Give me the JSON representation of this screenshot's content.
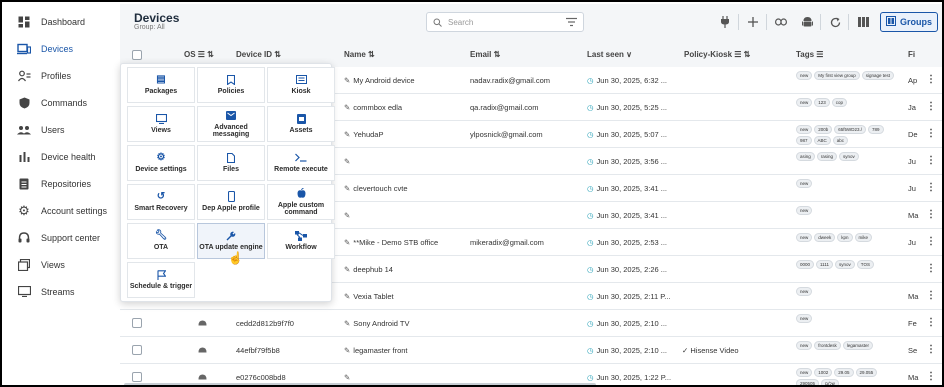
{
  "sidebar": {
    "items": [
      {
        "label": "Dashboard",
        "icon": "dashboard-icon"
      },
      {
        "label": "Devices",
        "icon": "devices-icon",
        "active": true
      },
      {
        "label": "Profiles",
        "icon": "profiles-icon"
      },
      {
        "label": "Commands",
        "icon": "shield-icon"
      },
      {
        "label": "Users",
        "icon": "users-icon"
      },
      {
        "label": "Device health",
        "icon": "bar-chart-icon"
      },
      {
        "label": "Repositories",
        "icon": "repositories-icon"
      },
      {
        "label": "Account settings",
        "icon": "gear-icon"
      },
      {
        "label": "Support center",
        "icon": "headset-icon"
      },
      {
        "label": "Views",
        "icon": "views-icon"
      },
      {
        "label": "Streams",
        "icon": "streams-icon"
      }
    ]
  },
  "header": {
    "title": "Devices",
    "subtitle": "Group: All",
    "search_placeholder": "Search",
    "groups_label": "Groups",
    "accent": "#1a56a8"
  },
  "table": {
    "headers": {
      "os": "OS",
      "device_id": "Device ID",
      "name": "Name",
      "email": "Email",
      "last_seen": "Last seen",
      "policy": "Policy-Kiosk",
      "tags": "Tags",
      "extra": "Fi"
    },
    "rows": [
      {
        "device_id": "",
        "name": "My Android device",
        "email": "nadav.radix@gmail.com",
        "seen": "Jun 30, 2025, 6:32 ...",
        "policy": "",
        "tags": [
          "new",
          "My first view group",
          "signage test"
        ],
        "extra": "Ap"
      },
      {
        "device_id": "",
        "name": "commbox edla",
        "email": "qa.radix@gmail.com",
        "seen": "Jun 30, 2025, 5:25 ...",
        "policy": "",
        "tags": [
          "new",
          "123",
          "cop"
        ],
        "extra": "Ja"
      },
      {
        "device_id": "",
        "name": "YehudaP",
        "email": "ylposnick@gmail.com",
        "seen": "Jun 30, 2025, 5:07 ...",
        "policy": "",
        "tags": [
          "new",
          "200b",
          "65f5WD23./",
          "789",
          "987",
          "ABC",
          "abc"
        ],
        "extra": "De"
      },
      {
        "device_id": "",
        "name": "",
        "email": "",
        "seen": "Jun 30, 2025, 3:56 ...",
        "policy": "",
        "tags": [
          "asing",
          "rasing",
          "synov"
        ],
        "extra": "Ju"
      },
      {
        "device_id": "",
        "name": "clevertouch cvte",
        "email": "",
        "seen": "Jun 30, 2025, 3:41 ...",
        "policy": "",
        "tags": [
          "new"
        ],
        "extra": "Ju"
      },
      {
        "device_id": "",
        "name": "",
        "email": "",
        "seen": "Jun 30, 2025, 3:41 ...",
        "policy": "",
        "tags": [
          "new"
        ],
        "extra": "Ma"
      },
      {
        "device_id": "",
        "name": "**Mike - Demo STB office",
        "email": "mikeradix@gmail.com",
        "seen": "Jun 30, 2025, 2:53 ...",
        "policy": "",
        "tags": [
          "new",
          "dweek",
          "kpn",
          "mike"
        ],
        "extra": "Ju"
      },
      {
        "device_id": "",
        "name": "deephub 14",
        "email": "",
        "seen": "Jun 30, 2025, 2:26 ...",
        "policy": "",
        "tags": [
          "0000",
          "1111",
          "synov",
          "TOS"
        ],
        "extra": ""
      },
      {
        "device_id": "",
        "name": "Vexia Tablet",
        "email": "",
        "seen": "Jun 30, 2025, 2:11 P...",
        "policy": "",
        "tags": [
          "new"
        ],
        "extra": "Ma"
      },
      {
        "device_id": "cedd2d812b9f7f0",
        "name": "Sony Android TV",
        "email": "",
        "seen": "Jun 30, 2025, 2:10 ...",
        "policy": "",
        "tags": [
          "new"
        ],
        "extra": "Fe"
      },
      {
        "device_id": "44efbf79f5b8",
        "name": "legamaster front",
        "email": "",
        "seen": "Jun 30, 2025, 2:10 ...",
        "policy": "Hisense Video",
        "tags": [
          "new",
          "frontdesk",
          "legamaster"
        ],
        "extra": "Se"
      },
      {
        "device_id": "e0276c008bd8",
        "name": "",
        "email": "",
        "seen": "Jun 30, 2025, 1:22 P...",
        "policy": "",
        "tags": [
          "new",
          "1002",
          "29.05",
          "29.055",
          "290505",
          "שלום"
        ],
        "extra": "Ma"
      }
    ]
  },
  "menu": {
    "tiles": [
      {
        "label": "Packages",
        "icon": "package-icon"
      },
      {
        "label": "Policies",
        "icon": "bookmark-icon"
      },
      {
        "label": "Kiosk",
        "icon": "kiosk-icon"
      },
      {
        "label": "Views",
        "icon": "monitor-icon"
      },
      {
        "label": "Advanced messaging",
        "icon": "message-icon"
      },
      {
        "label": "Assets",
        "icon": "assets-icon"
      },
      {
        "label": "Device settings",
        "icon": "gear-icon"
      },
      {
        "label": "Files",
        "icon": "file-icon"
      },
      {
        "label": "Remote execute",
        "icon": "terminal-icon"
      },
      {
        "label": "Smart Recovery",
        "icon": "recovery-icon"
      },
      {
        "label": "Dep Apple profile",
        "icon": "phone-icon"
      },
      {
        "label": "Apple custom command",
        "icon": "apple-icon"
      },
      {
        "label": "OTA",
        "icon": "wrench-icon"
      },
      {
        "label": "OTA update engine",
        "icon": "wrench-icon",
        "hover": true
      },
      {
        "label": "Workflow",
        "icon": "workflow-icon"
      },
      {
        "label": "Schedule & trigger",
        "icon": "flag-icon"
      }
    ]
  }
}
